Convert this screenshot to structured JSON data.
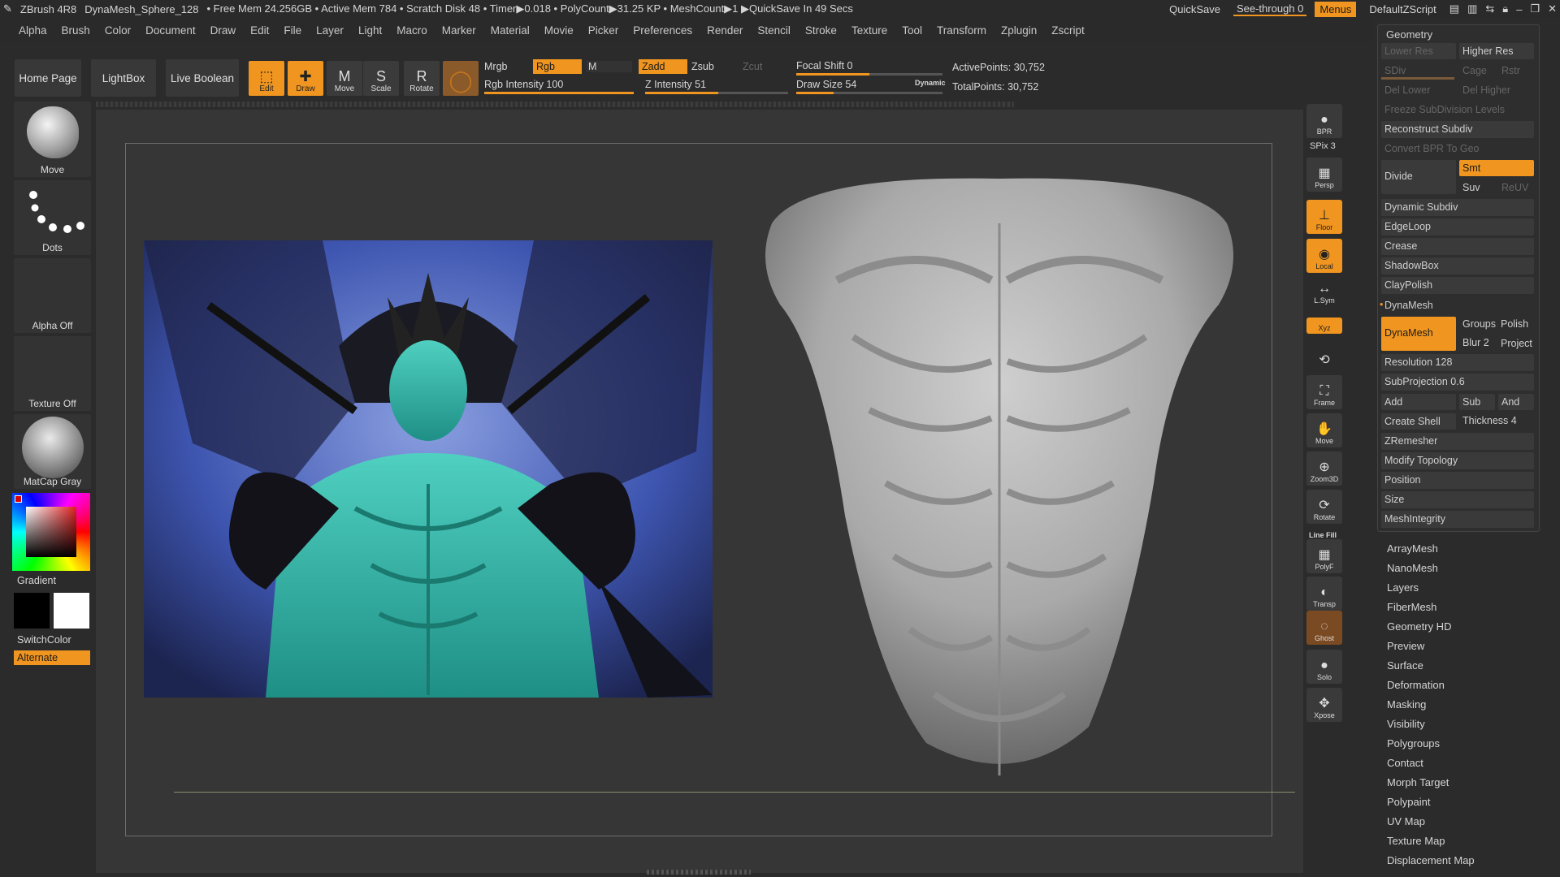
{
  "titlebar": {
    "app": "ZBrush 4R8",
    "doc": "DynaMesh_Sphere_128",
    "stats": "• Free Mem 24.256GB • Active Mem 784 • Scratch Disk 48 • Timer▶0.018 • PolyCount▶31.25 KP • MeshCount▶1 ▶QuickSave In 49 Secs",
    "quicksave": "QuickSave",
    "see_through": "See-through  0",
    "menus": "Menus",
    "script": "DefaultZScript"
  },
  "menu": [
    "Alpha",
    "Brush",
    "Color",
    "Document",
    "Draw",
    "Edit",
    "File",
    "Layer",
    "Light",
    "Macro",
    "Marker",
    "Material",
    "Movie",
    "Picker",
    "Preferences",
    "Render",
    "Stencil",
    "Stroke",
    "Texture",
    "Tool",
    "Transform",
    "Zplugin",
    "Zscript"
  ],
  "toolbar": {
    "home": "Home Page",
    "lightbox": "LightBox",
    "live_boolean": "Live Boolean",
    "edit": "Edit",
    "draw": "Draw",
    "move": "Move",
    "scale": "Scale",
    "rotate": "Rotate",
    "mrgb": "Mrgb",
    "rgb": "Rgb",
    "m": "M",
    "zadd": "Zadd",
    "zsub": "Zsub",
    "zcut": "Zcut",
    "rgb_intensity": "Rgb Intensity 100",
    "rgb_intensity_value": 1.0,
    "z_intensity": "Z Intensity 51",
    "z_intensity_value": 0.51,
    "focal_shift": "Focal Shift 0",
    "draw_size": "Draw Size 54",
    "dynamic": "Dynamic",
    "active_points": "ActivePoints: 30,752",
    "total_points": "TotalPoints: 30,752"
  },
  "left": {
    "brush": "Move",
    "stroke": "Dots",
    "alpha": "Alpha Off",
    "texture": "Texture Off",
    "material": "MatCap Gray",
    "gradient": "Gradient",
    "switch": "SwitchColor",
    "alternate": "Alternate"
  },
  "right_shelf": {
    "bpr": "BPR",
    "spix": "SPix 3",
    "persp": "Persp",
    "floor": "Floor",
    "local": "Local",
    "lsym": "L.Sym",
    "xyz": "Xyz",
    "frame": "Frame",
    "move": "Move",
    "zoom": "Zoom3D",
    "rotate": "Rotate",
    "linefill": "Line Fill",
    "polyf": "PolyF",
    "transp": "Transp",
    "ghost": "Ghost",
    "solo": "Solo",
    "xpose": "Xpose"
  },
  "geometry": {
    "title": "Geometry",
    "lower_res": "Lower Res",
    "higher_res": "Higher Res",
    "sdiv": "SDiv",
    "cage": "Cage",
    "rstr": "Rstr",
    "del_lower": "Del Lower",
    "del_higher": "Del Higher",
    "freeze": "Freeze SubDivision Levels",
    "reconstruct": "Reconstruct Subdiv",
    "convert": "Convert BPR To Geo",
    "divide": "Divide",
    "smt": "Smt",
    "suv": "Suv",
    "reuv": "ReUV",
    "dynamic_subdiv": "Dynamic Subdiv",
    "edgeloop": "EdgeLoop",
    "crease": "Crease",
    "shadowbox": "ShadowBox",
    "claypolish": "ClayPolish",
    "dynamesh_header": "DynaMesh",
    "dynamesh_btn": "DynaMesh",
    "groups": "Groups",
    "polish": "Polish",
    "blur": "Blur 2",
    "project": "Project",
    "resolution": "Resolution 128",
    "subprojection": "SubProjection 0.6",
    "add": "Add",
    "sub": "Sub",
    "and": "And",
    "create_shell": "Create Shell",
    "thickness": "Thickness 4",
    "zremesher": "ZRemesher",
    "modify_topology": "Modify Topology",
    "position": "Position",
    "size": "Size",
    "meshintegrity": "MeshIntegrity"
  },
  "tool_sections": [
    "ArrayMesh",
    "NanoMesh",
    "Layers",
    "FiberMesh",
    "Geometry HD",
    "Preview",
    "Surface",
    "Deformation",
    "Masking",
    "Visibility",
    "Polygroups",
    "Contact",
    "Morph Target",
    "Polypaint",
    "UV Map",
    "Texture Map",
    "Displacement Map"
  ]
}
